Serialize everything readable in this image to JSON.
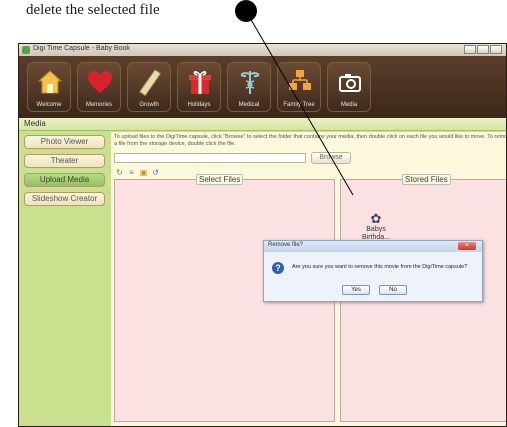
{
  "annotation": {
    "text": "delete the selected file"
  },
  "window": {
    "title": "Digi Time Capsule - Baby Book"
  },
  "toolbar": {
    "buttons": [
      {
        "label": "Welcome",
        "icon": "house-icon"
      },
      {
        "label": "Memories",
        "icon": "heart-icon"
      },
      {
        "label": "Growth",
        "icon": "ruler-icon"
      },
      {
        "label": "Holidays",
        "icon": "gift-icon"
      },
      {
        "label": "Medical",
        "icon": "caduceus-icon"
      },
      {
        "label": "Family Tree",
        "icon": "family-tree-icon"
      },
      {
        "label": "Media",
        "icon": "camera-icon"
      }
    ]
  },
  "media": {
    "section_title": "Media",
    "sidebar": [
      "Photo Viewer",
      "Theater",
      "Upload Media",
      "Slideshow Creator"
    ],
    "active_item": "Upload Media",
    "instructions": "To upload files to the DigiTime capsule, click \"Browse\" to select the folder that contains your media, then double click on each file you would like to move. To remove a file from the storage device, double click the file.",
    "path_value": "",
    "browse_label": "Browse",
    "select_files_label": "Select Files",
    "stored_files_label": "Stored Files",
    "stored_file": {
      "name_line1": "Babys",
      "name_line2": "Birthda..."
    }
  },
  "dialog": {
    "title": "Remove file?",
    "message": "Are you sure you want to remove this movie from the DigiTime capsule?",
    "yes_label": "Yes",
    "no_label": "No"
  }
}
